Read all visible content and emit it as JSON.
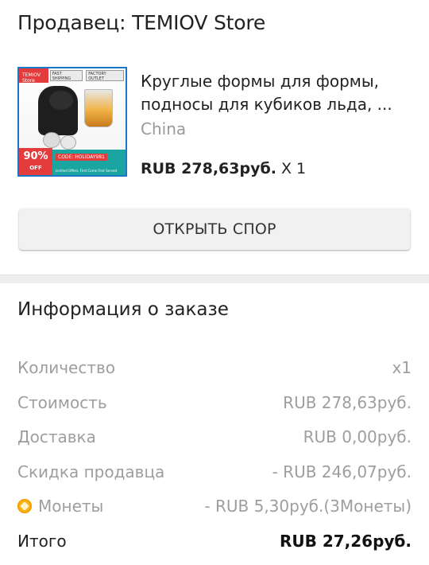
{
  "seller": {
    "title": "Продавец: TEMIOV Store"
  },
  "product": {
    "thumbnail": {
      "store_tag": "TEMIOV Store",
      "ship_tag": "FAST SHIPPING",
      "outlet_tag": "FACTORY OUTLET",
      "discount": "90%",
      "discount_suffix": "OFF",
      "code": "CODE: HOLIDAY981",
      "fine_print": "Limited Offers, First Come First Served"
    },
    "name": "Круглые формы для формы, подносы для кубиков льда, ...",
    "origin": "China",
    "price": "RUB 278,63руб.",
    "quantity": "X 1"
  },
  "actions": {
    "dispute_label": "ОТКРЫТЬ СПОР"
  },
  "order_info": {
    "title": "Информация о заказе",
    "rows": [
      {
        "label": "Количество",
        "value": "x1"
      },
      {
        "label": "Стоимость",
        "value": "RUB 278,63руб."
      },
      {
        "label": "Доставка",
        "value": "RUB 0,00руб."
      },
      {
        "label": "Скидка продавца",
        "value": "- RUB 246,07руб."
      },
      {
        "label": "Монеты",
        "value": "- RUB 5,30руб.(3Монеты)",
        "icon": "coin-icon"
      },
      {
        "label": "Итого",
        "value": "RUB 27,26руб."
      }
    ]
  },
  "colors": {
    "coin": "#f6b61a",
    "muted_text": "#9e9e9e",
    "button_bg": "#f1f1f1"
  }
}
